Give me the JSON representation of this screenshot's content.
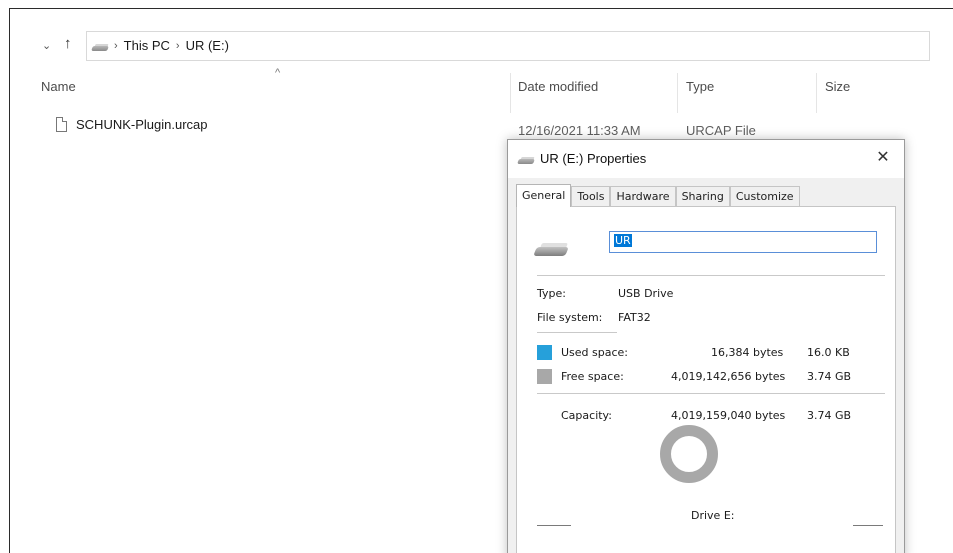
{
  "address_bar": {
    "chevron": "⌄",
    "up": "↑",
    "drive_icon": "usb-drive-icon",
    "crumbs": [
      "This PC",
      "UR (E:)"
    ],
    "separator": "›"
  },
  "columns": {
    "sort_indicator": "^",
    "headers": [
      "Name",
      "Date modified",
      "Type",
      "Size"
    ]
  },
  "files": [
    {
      "name": "SCHUNK-Plugin.urcap",
      "date_modified": "12/16/2021 11:33 AM",
      "type": "URCAP File",
      "size": "",
      "icon": "file-icon"
    }
  ],
  "dialog": {
    "title": "UR (E:) Properties",
    "close_glyph": "✕",
    "tabs": [
      "General",
      "Tools",
      "Hardware",
      "Sharing",
      "Customize"
    ],
    "active_tab": "General",
    "name_value": "UR",
    "type_label": "Type:",
    "type_value": "USB Drive",
    "fs_label": "File system:",
    "fs_value": "FAT32",
    "used_label": "Used space:",
    "used_bytes": "16,384 bytes",
    "used_size": "16.0 KB",
    "used_color": "#26a0da",
    "free_label": "Free space:",
    "free_bytes": "4,019,142,656 bytes",
    "free_size": "3.74 GB",
    "free_color": "#a8a8a8",
    "capacity_label": "Capacity:",
    "capacity_bytes": "4,019,159,040 bytes",
    "capacity_size": "3.74 GB",
    "used_fraction": 4e-06,
    "drive_label": "Drive E:"
  }
}
